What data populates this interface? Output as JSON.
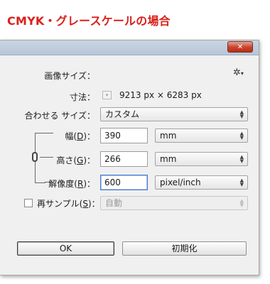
{
  "caption": "CMYK・グレースケールの場合",
  "window": {
    "close_label": "✕"
  },
  "image_size": {
    "label": "画像サイズ：",
    "gear_icon": "gear-icon"
  },
  "dimensions": {
    "label": "寸法：",
    "value": "9213 px × 6283 px"
  },
  "fit_to": {
    "label": "合わせる サイズ：",
    "value": "カスタム"
  },
  "width": {
    "label_pre": "幅(",
    "key": "D",
    "label_post": ")：",
    "value": "390",
    "unit": "mm"
  },
  "height": {
    "label_pre": "高さ(",
    "key": "G",
    "label_post": ")：",
    "value": "266",
    "unit": "mm"
  },
  "resolution": {
    "label_pre": "解像度(",
    "key": "R",
    "label_post": ")：",
    "value": "600",
    "unit": "pixel/inch"
  },
  "resample": {
    "label_pre": "再サンプル(",
    "key": "S",
    "label_post": ")：",
    "value": "自動",
    "checked": false
  },
  "buttons": {
    "ok": "OK",
    "reset": "初期化"
  }
}
